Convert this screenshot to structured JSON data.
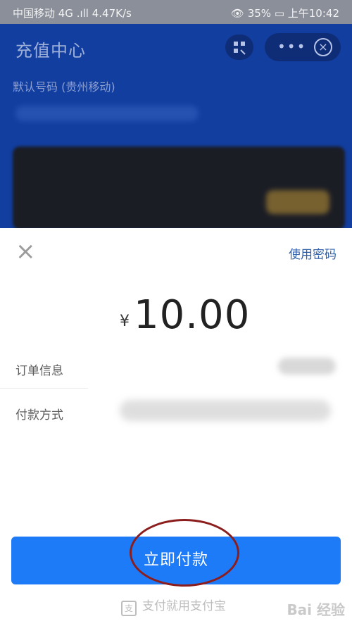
{
  "statusBar": {
    "left": "中国移动 4G .ıll  4.47K/s",
    "right": "👁 35% ▭ 上午10:42"
  },
  "background": {
    "title": "充值中心",
    "subtitle": "默认号码 (贵州移动)",
    "more": "•••",
    "close": "×"
  },
  "sheet": {
    "close": "×",
    "usePassword": "使用密码",
    "currency": "¥",
    "amount": "10.00",
    "orderInfoLabel": "订单信息",
    "paymentMethodLabel": "付款方式",
    "payButton": "立即付款",
    "footer": "支付就用支付宝",
    "watermark": "Bai 经验"
  }
}
